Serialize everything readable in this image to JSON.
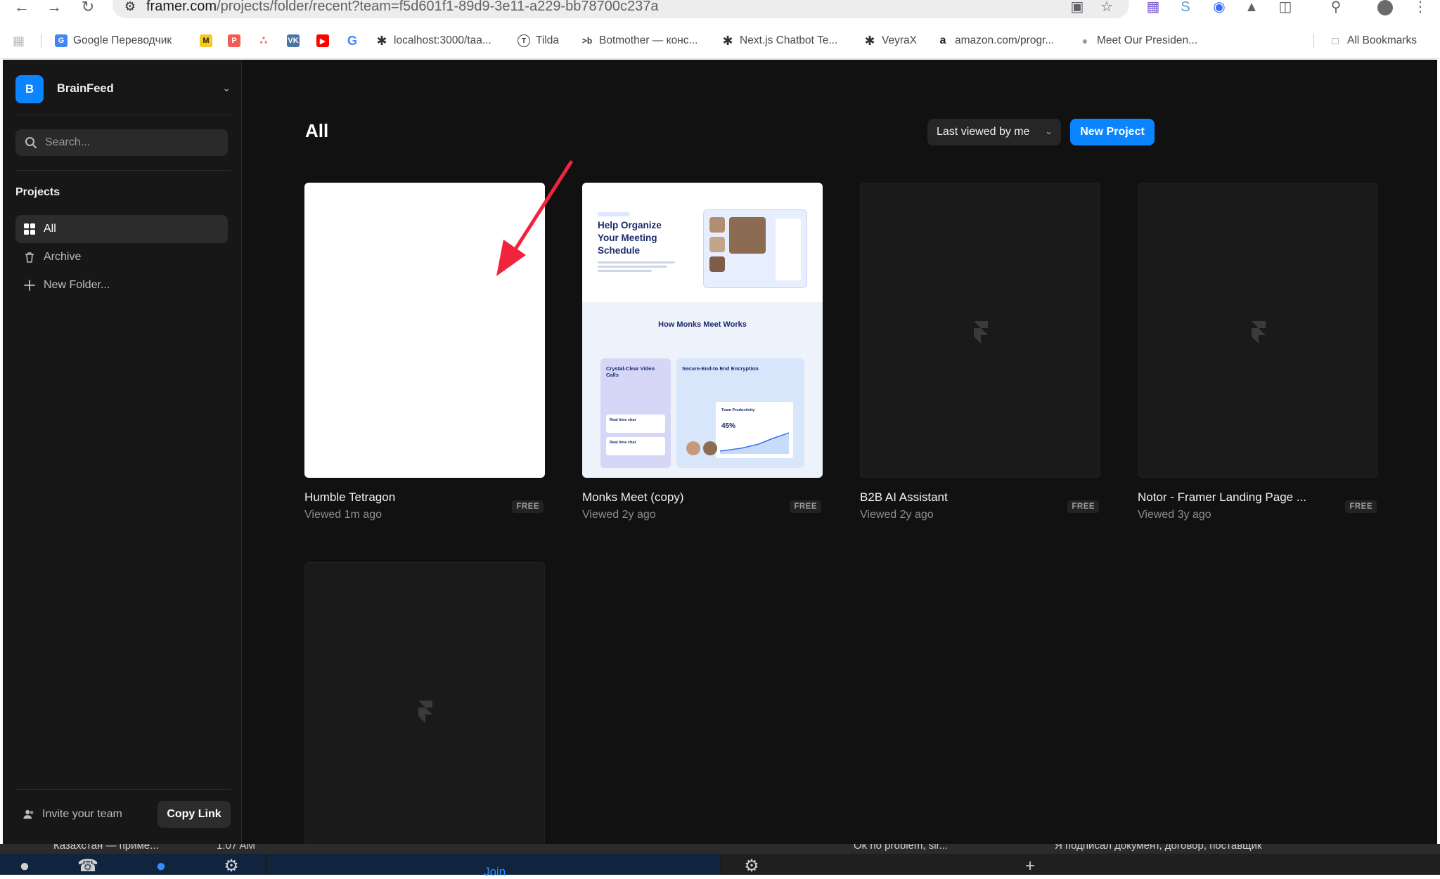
{
  "browser": {
    "url_host": "framer.com",
    "url_path": "/projects/folder/recent?team=f5d601f1-89d9-3e11-a229-bb78700c237a",
    "bookmarks": [
      {
        "label": "Google Переводчик",
        "icon": "google-translate-icon",
        "color": "#4285f4"
      },
      {
        "label": "",
        "icon": "miro-icon",
        "color": "#f7c922"
      },
      {
        "label": "",
        "icon": "p-icon",
        "color": "#f25c54"
      },
      {
        "label": "",
        "icon": "asana-icon",
        "color": "#f06a6a"
      },
      {
        "label": "",
        "icon": "vk-icon",
        "color": "#4c75a3"
      },
      {
        "label": "",
        "icon": "youtube-icon",
        "color": "#ff0000"
      },
      {
        "label": "",
        "icon": "google-icon",
        "color": "#4285f4"
      },
      {
        "label": "localhost:3000/taa...",
        "icon": "spark-icon",
        "color": "#333333"
      },
      {
        "label": "Tilda",
        "icon": "tilda-icon",
        "color": "#333333"
      },
      {
        "label": "Botmother — конс...",
        "icon": "botmother-icon",
        "color": "#333333"
      },
      {
        "label": "Next.js Chatbot Te...",
        "icon": "spark-icon",
        "color": "#333333"
      },
      {
        "label": "VeyraX",
        "icon": "spark-icon",
        "color": "#333333"
      },
      {
        "label": "amazon.com/progr...",
        "icon": "amazon-icon",
        "color": "#222222"
      },
      {
        "label": "Meet Our Presiden...",
        "icon": "globe-icon",
        "color": "#888888"
      }
    ],
    "all_bookmarks": "All Bookmarks"
  },
  "sidebar": {
    "team_initial": "B",
    "team_name": "BrainFeed",
    "search_placeholder": "Search...",
    "projects_heading": "Projects",
    "items": [
      {
        "label": "All",
        "icon": "grid-icon",
        "active": true
      },
      {
        "label": "Archive",
        "icon": "trash-icon",
        "active": false
      },
      {
        "label": "New Folder...",
        "icon": "plus-icon",
        "active": false
      }
    ],
    "invite_label": "Invite your team",
    "copy_link_label": "Copy Link"
  },
  "main": {
    "title": "All",
    "sort_label": "Last viewed by me",
    "new_project_label": "New Project",
    "projects": [
      {
        "name": "Humble Tetragon",
        "viewed": "Viewed 1m ago",
        "badge": "FREE",
        "thumb": "blank-white"
      },
      {
        "name": "Monks Meet (copy)",
        "viewed": "Viewed 2y ago",
        "badge": "FREE",
        "thumb": "monks-preview"
      },
      {
        "name": "B2B AI Assistant",
        "viewed": "Viewed 2y ago",
        "badge": "FREE",
        "thumb": "framer-placeholder"
      },
      {
        "name": "Notor - Framer Landing Page ...",
        "viewed": "Viewed 3y ago",
        "badge": "FREE",
        "thumb": "framer-placeholder"
      },
      {
        "name": "",
        "viewed": "",
        "badge": "",
        "thumb": "framer-placeholder"
      }
    ],
    "monks_preview": {
      "hero_title": "Help Organize Your Meeting Schedule",
      "section_title": "How Monks Meet Works",
      "box1_title": "Crystal-Clear Video Calls",
      "box2_title": "Secure-End-to End Encryption",
      "chat1": "Real time chat",
      "chat2": "Real time chat",
      "stat": "45%",
      "stat_label": "Team Productivity"
    }
  },
  "taskbar": {
    "strip_text_1": "Казахстан — приме...",
    "strip_time": "1:07 AM",
    "strip_text_2": "Ok no problem, sir...",
    "strip_text_3": "Я подписал документ, договор, поставщик",
    "join_label": "Join"
  },
  "colors": {
    "accent": "#0a84ff",
    "app_bg": "#111111",
    "sidebar_bg": "#171717",
    "arrow": "#f0253d"
  }
}
